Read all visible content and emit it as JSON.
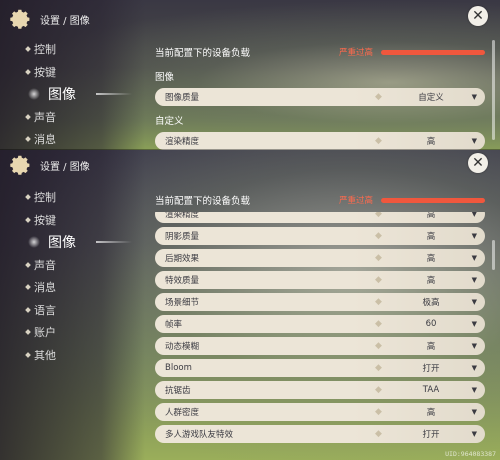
{
  "breadcrumb": "设置 / 图像",
  "close_glyph": "✕",
  "nav": [
    "控制",
    "按键",
    "图像",
    "声音",
    "消息",
    "语言",
    "账户",
    "其他"
  ],
  "nav_active": "图像",
  "device_load": {
    "title": "当前配置下的设备负载",
    "status": "严重过高",
    "status_color": "#ff6a4d",
    "bar_color": "#f0573d",
    "level": 1.0
  },
  "top_panel": {
    "section_image": "图像",
    "image_quality": {
      "label": "图像质量",
      "value": "自定义"
    },
    "section_custom": "自定义",
    "render_precision": {
      "label": "渲染精度",
      "value": "高"
    }
  },
  "settings_rows": [
    {
      "label": "渲染精度",
      "value": "高"
    },
    {
      "label": "阴影质量",
      "value": "高"
    },
    {
      "label": "后期效果",
      "value": "高"
    },
    {
      "label": "特效质量",
      "value": "高"
    },
    {
      "label": "场景细节",
      "value": "极高"
    },
    {
      "label": "帧率",
      "value": "60"
    },
    {
      "label": "动态模糊",
      "value": "高"
    },
    {
      "label": "Bloom",
      "value": "打开"
    },
    {
      "label": "抗锯齿",
      "value": "TAA"
    },
    {
      "label": "人群密度",
      "value": "高"
    },
    {
      "label": "多人游戏队友特效",
      "value": "打开"
    }
  ],
  "uid": "UID:964083387",
  "icons": {
    "gear": "gear-icon",
    "close": "close-icon",
    "chevron": "chevron-down-icon"
  }
}
